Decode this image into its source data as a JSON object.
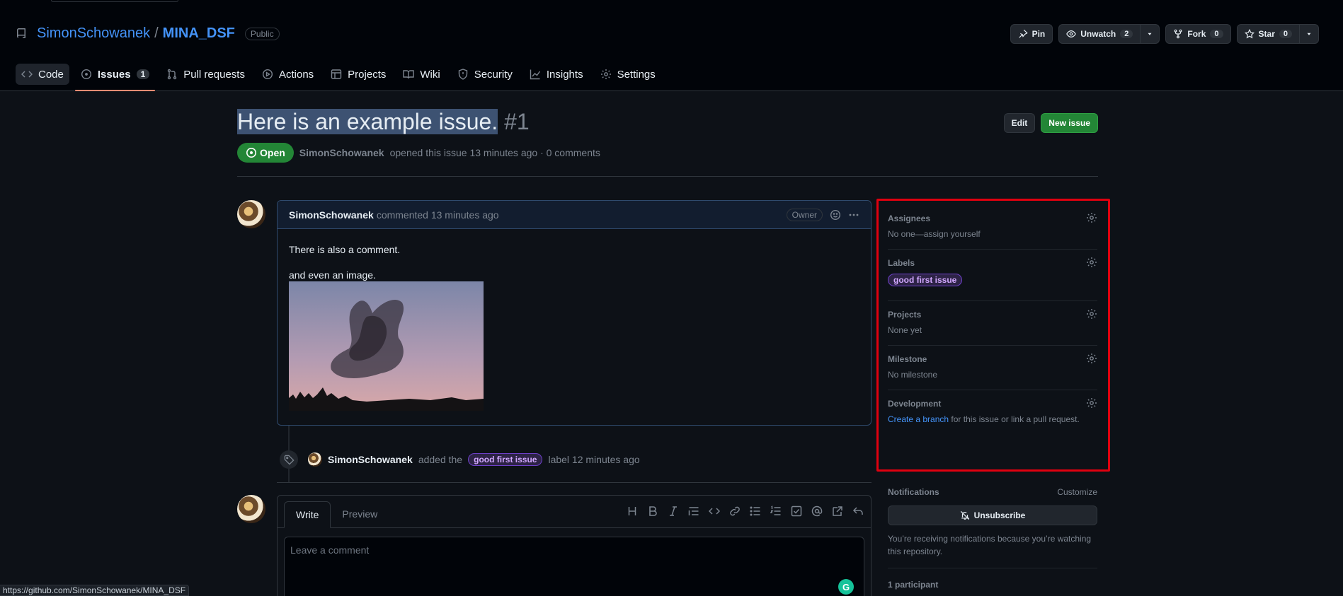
{
  "repo": {
    "owner": "SimonSchowanek",
    "separator": "/",
    "name": "MINA_DSF",
    "visibility": "Public",
    "actions": {
      "pin_label": "Pin",
      "unwatch_label": "Unwatch",
      "unwatch_count": "2",
      "fork_label": "Fork",
      "fork_count": "0",
      "star_label": "Star",
      "star_count": "0"
    }
  },
  "tabs": [
    {
      "label": "Code"
    },
    {
      "label": "Issues",
      "count": "1"
    },
    {
      "label": "Pull requests"
    },
    {
      "label": "Actions"
    },
    {
      "label": "Projects"
    },
    {
      "label": "Wiki"
    },
    {
      "label": "Security"
    },
    {
      "label": "Insights"
    },
    {
      "label": "Settings"
    }
  ],
  "issue": {
    "title": "Here is an example issue.",
    "number": "#1",
    "edit_label": "Edit",
    "new_issue_label": "New issue",
    "state": "Open",
    "author": "SimonSchowanek",
    "meta_text": "opened this issue 13 minutes ago · 0 comments"
  },
  "comment": {
    "author": "SimonSchowanek",
    "meta": "commented 13 minutes ago",
    "role": "Owner",
    "body_line1": "There is also a comment.",
    "body_line2": "and even an image."
  },
  "event": {
    "actor": "SimonSchowanek",
    "text_before": "added the",
    "label": "good first issue",
    "text_after": "label 12 minutes ago"
  },
  "composer": {
    "tab_write": "Write",
    "tab_preview": "Preview",
    "placeholder": "Leave a comment",
    "grammarly_glyph": "G"
  },
  "sidebar": {
    "assignees": {
      "heading": "Assignees",
      "value": "No one—assign yourself"
    },
    "labels": {
      "heading": "Labels",
      "label": "good first issue"
    },
    "projects": {
      "heading": "Projects",
      "value": "None yet"
    },
    "milestone": {
      "heading": "Milestone",
      "value": "No milestone"
    },
    "development": {
      "heading": "Development",
      "link": "Create a branch",
      "text": "for this issue or link a pull request."
    }
  },
  "notifications": {
    "heading": "Notifications",
    "customize": "Customize",
    "unsubscribe": "Unsubscribe",
    "text": "You’re receiving notifications because you’re watching this repository.",
    "participants": "1 participant"
  },
  "status_bar": {
    "url": "https://github.com/SimonSchowanek/MINA_DSF"
  },
  "colors": {
    "accent_link": "#4493f8",
    "open_green": "#238636",
    "tab_underline": "#fd8c73",
    "highlight_box": "#e0000f",
    "label_purple": "#d2a8ff"
  }
}
